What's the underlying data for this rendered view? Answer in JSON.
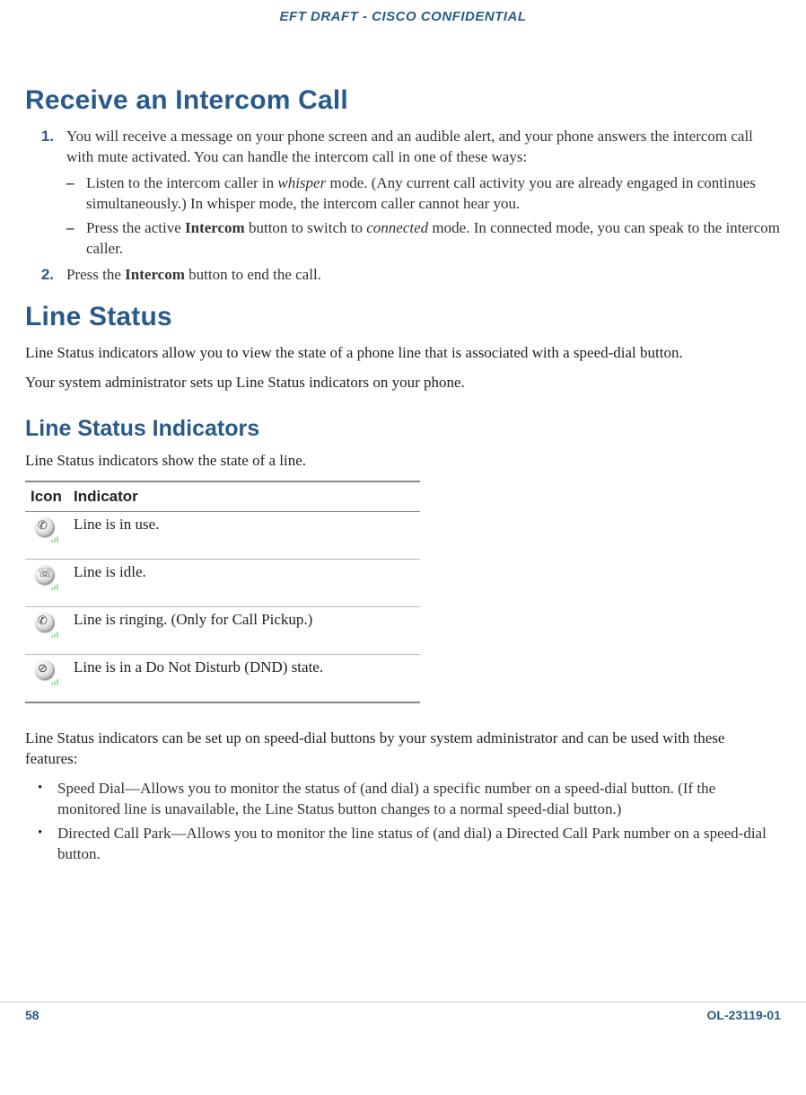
{
  "header": {
    "confidential": "EFT DRAFT - CISCO CONFIDENTIAL"
  },
  "section1": {
    "title": "Receive an Intercom Call",
    "step1_num": "1.",
    "step1_text_a": "You will receive a message on your phone screen and an audible alert, and your phone answers the intercom call with mute activated. You can handle the intercom call in one of these ways:",
    "sub1_a": "Listen to the intercom caller in ",
    "sub1_b_italic": "whisper",
    "sub1_c": " mode. (Any current call activity you are already engaged in continues simultaneously.) In whisper mode, the intercom caller cannot hear you.",
    "sub2_a": "Press the active ",
    "sub2_b_bold": "Intercom",
    "sub2_c": " button to switch to ",
    "sub2_d_italic": "connected",
    "sub2_e": " mode. In connected mode, you can speak to the intercom caller.",
    "step2_num": "2.",
    "step2_a": "Press the ",
    "step2_b_bold": "Intercom",
    "step2_c": " button to end the call."
  },
  "section2": {
    "title": "Line Status",
    "p1": "Line Status indicators allow you to view the state of a phone line that is associated with a speed-dial button.",
    "p2": "Your system administrator sets up Line Status indicators on your phone."
  },
  "section3": {
    "title": "Line Status Indicators",
    "p1": "Line Status indicators show the state of a line.",
    "table": {
      "h1": "Icon",
      "h2": "Indicator",
      "rows": [
        {
          "icon": "line-in-use-icon",
          "glyph": "✆",
          "text": "Line is in use."
        },
        {
          "icon": "line-idle-icon",
          "glyph": "☏",
          "text": "Line is idle."
        },
        {
          "icon": "line-ringing-icon",
          "glyph": "✆",
          "text": "Line is ringing. (Only for Call Pickup.)"
        },
        {
          "icon": "line-dnd-icon",
          "glyph": "⊘",
          "text": "Line is in a Do Not Disturb (DND) state."
        }
      ]
    },
    "p2": "Line Status indicators can be set up on speed-dial buttons by your system administrator and can be used with these features:",
    "bullet1": "Speed Dial—Allows you to monitor the status of (and dial) a specific number on a speed-dial button. (If the monitored line is unavailable, the Line Status button changes to a normal speed-dial button.)",
    "bullet2": "Directed Call Park—Allows you to monitor the line status of (and dial) a Directed Call Park number on a speed-dial button."
  },
  "footer": {
    "page": "58",
    "docid": "OL-23119-01"
  }
}
